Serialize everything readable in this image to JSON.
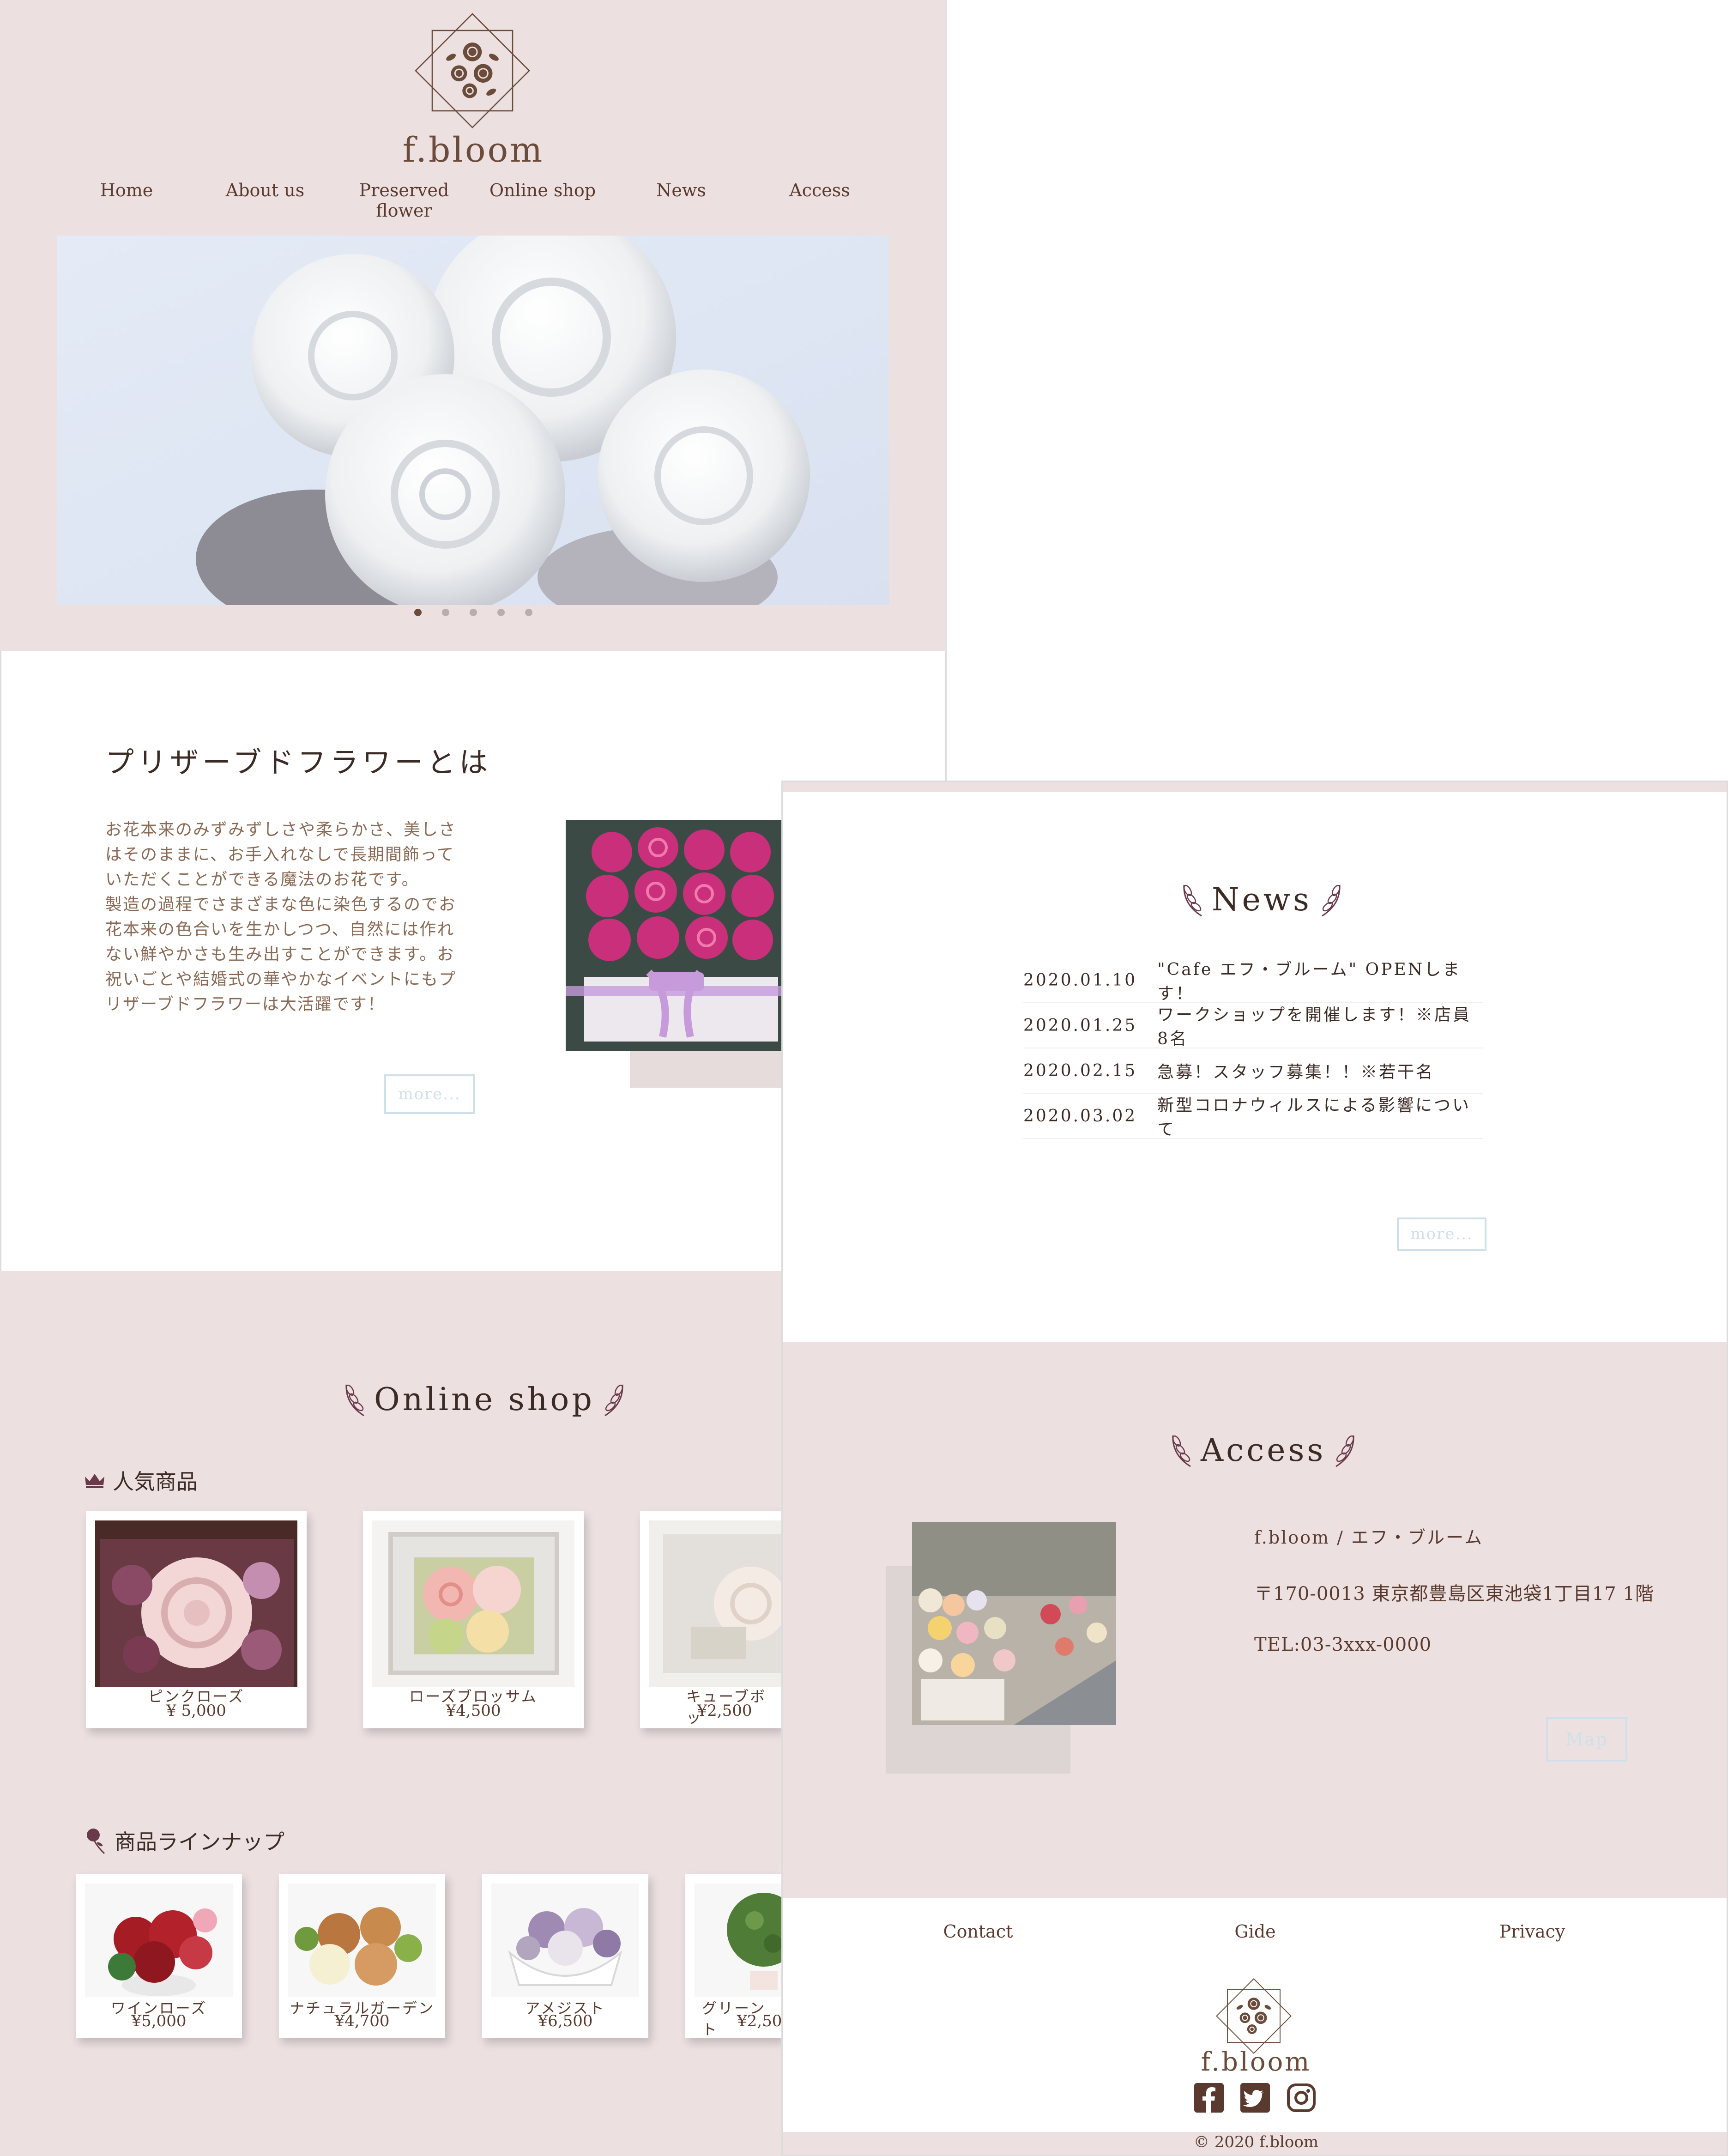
{
  "brand": {
    "name": "f.bloom"
  },
  "nav": {
    "items": [
      "Home",
      "About us",
      "Preserved flower",
      "Online shop",
      "News",
      "Access"
    ]
  },
  "slider": {
    "dots": 5,
    "active": 0
  },
  "about": {
    "title": "プリザーブドフラワーとは",
    "text": "お花本来のみずみずしさや柔らかさ、美しさはそのままに、お手入れなしで長期間飾っていただくことができる魔法のお花です。\n製造の過程でさまざまな色に染色するのでお花本来の色合いを生かしつつ、自然には作れない鮮やかさも生み出すことができます。お祝いごとや結婚式の華やかなイベントにもプリザーブドフラワーは大活躍です！",
    "more": "more..."
  },
  "shop": {
    "title": "Online shop",
    "popular_title": "人気商品",
    "popular": [
      {
        "name": "ピンクローズ",
        "price": "¥ 5,000"
      },
      {
        "name": "ローズブロッサム",
        "price": "¥4,500"
      },
      {
        "name": "キューブボッ",
        "price": "¥2,500"
      }
    ],
    "lineup_title": "商品ラインナップ",
    "lineup": [
      {
        "name": "ワインローズ",
        "price": "¥5,000"
      },
      {
        "name": "ナチュラルガーデン",
        "price": "¥4,700"
      },
      {
        "name": "アメジスト",
        "price": "¥6,500"
      },
      {
        "name": "グリーント",
        "price": "¥2,50"
      }
    ]
  },
  "news": {
    "title": "News",
    "items": [
      {
        "date": "2020.01.10",
        "text": "\"Cafe エフ・ブルーム\" OPENします！"
      },
      {
        "date": "2020.01.25",
        "text": "ワークショップを開催します！※店員8名"
      },
      {
        "date": "2020.02.15",
        "text": "急募！スタッフ募集！！※若干名"
      },
      {
        "date": "2020.03.02",
        "text": "新型コロナウィルスによる影響について"
      }
    ],
    "more": "more..."
  },
  "access": {
    "title": "Access",
    "name": "f.bloom / エフ・ブルーム",
    "address": "〒170-0013 東京都豊島区東池袋1丁目17 1階",
    "tel": "TEL:03-3xxx-0000",
    "map": "Map"
  },
  "footer": {
    "links": [
      "Contact",
      "Gide",
      "Privacy"
    ],
    "copyright": "© 2020 f.bloom"
  },
  "colors": {
    "pink_bg": "#ece0e1",
    "brown": "#5a3a2e",
    "button_outline": "#cfe0ea"
  }
}
